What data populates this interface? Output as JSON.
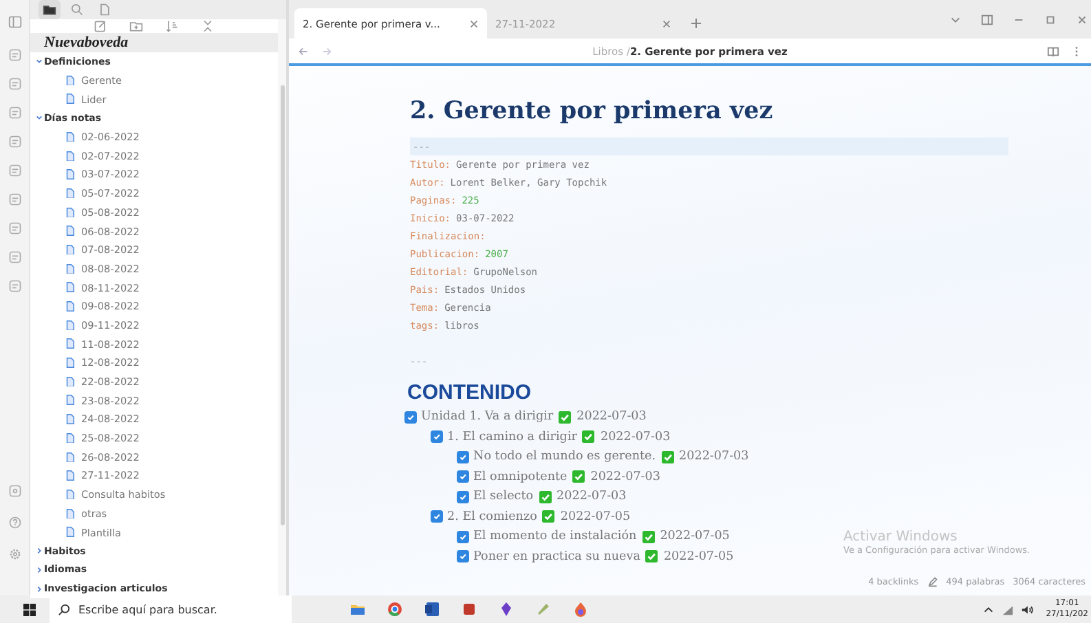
{
  "sidebar": {
    "tabs": [
      {
        "kind": "folder",
        "selected": true
      },
      {
        "kind": "search",
        "selected": false
      },
      {
        "kind": "file",
        "selected": false
      }
    ],
    "vault_name": "Nuevaboveda",
    "tree": [
      {
        "label": "Definiciones",
        "kind": "folder",
        "expanded": true,
        "children": [
          {
            "label": "Gerente",
            "kind": "file"
          },
          {
            "label": "Lider",
            "kind": "file"
          }
        ]
      },
      {
        "label": "Días notas",
        "kind": "folder",
        "expanded": true,
        "children": [
          {
            "label": "02-06-2022",
            "kind": "file"
          },
          {
            "label": "02-07-2022",
            "kind": "file"
          },
          {
            "label": "03-07-2022",
            "kind": "file"
          },
          {
            "label": "05-07-2022",
            "kind": "file"
          },
          {
            "label": "05-08-2022",
            "kind": "file"
          },
          {
            "label": "06-08-2022",
            "kind": "file"
          },
          {
            "label": "07-08-2022",
            "kind": "file"
          },
          {
            "label": "08-08-2022",
            "kind": "file"
          },
          {
            "label": "08-11-2022",
            "kind": "file"
          },
          {
            "label": "09-08-2022",
            "kind": "file"
          },
          {
            "label": "09-11-2022",
            "kind": "file"
          },
          {
            "label": "11-08-2022",
            "kind": "file"
          },
          {
            "label": "12-08-2022",
            "kind": "file"
          },
          {
            "label": "22-08-2022",
            "kind": "file"
          },
          {
            "label": "23-08-2022",
            "kind": "file"
          },
          {
            "label": "24-08-2022",
            "kind": "file"
          },
          {
            "label": "25-08-2022",
            "kind": "file"
          },
          {
            "label": "26-08-2022",
            "kind": "file"
          },
          {
            "label": "27-11-2022",
            "kind": "file"
          },
          {
            "label": "Consulta habitos",
            "kind": "file"
          },
          {
            "label": "otras",
            "kind": "file"
          },
          {
            "label": "Plantilla",
            "kind": "file"
          }
        ]
      },
      {
        "label": "Habitos",
        "kind": "folder",
        "expanded": false
      },
      {
        "label": "Idiomas",
        "kind": "folder",
        "expanded": false
      },
      {
        "label": "Investigacion articulos",
        "kind": "folder",
        "expanded": false
      }
    ]
  },
  "tabs": [
    {
      "label": "2. Gerente por primera v...",
      "selected": true
    },
    {
      "label": "27-11-2022",
      "selected": false
    }
  ],
  "breadcrumb": {
    "parent": "Libros /",
    "current": "2. Gerente por primera vez"
  },
  "note": {
    "title": "2. Gerente por primera vez",
    "frontmatter_open": "---",
    "frontmatter_close": "---",
    "properties": [
      {
        "key": "Titulo:",
        "value": "Gerente por primera vez",
        "kind": "text"
      },
      {
        "key": "Autor:",
        "value": "Lorent Belker, Gary Topchik",
        "kind": "text"
      },
      {
        "key": "Paginas:",
        "value": "225",
        "kind": "number"
      },
      {
        "key": "Inicio:",
        "value": "03-07-2022",
        "kind": "text"
      },
      {
        "key": "Finalizacion:"
      },
      {
        "key": "Publicacion:",
        "value": "2007",
        "kind": "number"
      },
      {
        "key": "Editorial:",
        "value": "GrupoNelson",
        "kind": "text"
      },
      {
        "key": "Pais:",
        "value": "Estados Unidos",
        "kind": "text"
      },
      {
        "key": "Tema:",
        "value": "Gerencia",
        "kind": "text"
      },
      {
        "key": "tags:",
        "value": "libros",
        "kind": "text"
      }
    ],
    "heading": "CONTENIDO",
    "tasks": [
      {
        "text": "Unidad 1. Va a dirigir",
        "checked": true,
        "done_date": "2022-07-03",
        "children": [
          {
            "text": "1. El camino a dirigir",
            "checked": true,
            "done_date": "2022-07-03",
            "children": [
              {
                "text": "No todo el mundo es gerente.",
                "checked": true,
                "done_date": "2022-07-03"
              },
              {
                "text": "El omnipotente",
                "checked": true,
                "done_date": "2022-07-03"
              },
              {
                "text": "El selecto",
                "checked": true,
                "done_date": "2022-07-03"
              }
            ]
          },
          {
            "text": "2. El comienzo",
            "checked": true,
            "done_date": "2022-07-05",
            "children": [
              {
                "text": "El  momento de instalación",
                "checked": true,
                "done_date": "2022-07-05"
              },
              {
                "text": "Poner en practica su nueva",
                "checked": true,
                "done_date": "2022-07-05"
              }
            ]
          }
        ]
      }
    ]
  },
  "status_bar": {
    "backlinks": "4 backlinks",
    "words": "494 palabras",
    "characters": "3064 caracteres"
  },
  "activation_notice": {
    "title": "Activar Windows",
    "subtitle": "Ve a Configuración para activar Windows."
  },
  "taskbar": {
    "search_placeholder": "Escribe aquí para buscar.",
    "time": "17:01",
    "date": "27/11/202"
  }
}
